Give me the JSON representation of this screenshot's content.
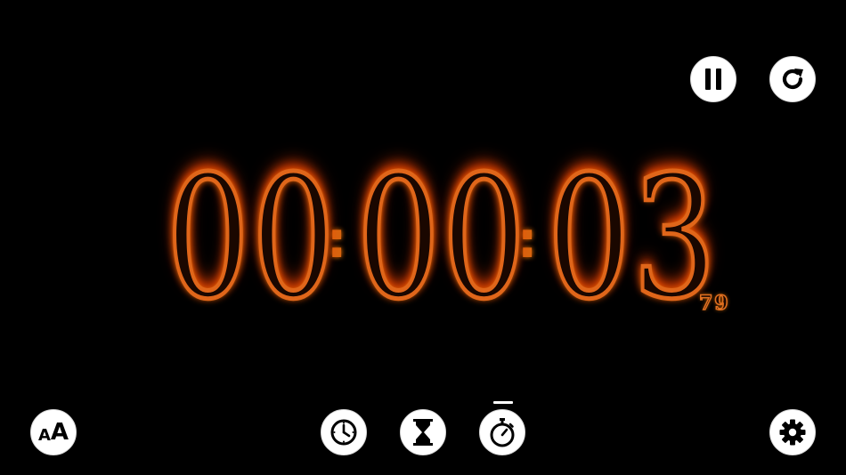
{
  "clock": {
    "digits": [
      "0",
      "0",
      "0",
      "0",
      "0",
      "3"
    ],
    "separator": ":",
    "hundredths": "79"
  },
  "controls": {
    "font_small": "A",
    "font_big": "A"
  },
  "modes": {
    "active": "stopwatch"
  },
  "colors": {
    "background": "#000000",
    "button_fill": "#ffffff",
    "icon": "#000000",
    "fire_outer": "#ff6a00",
    "fire_inner": "#e0661a"
  },
  "icons": {
    "pause": "pause-icon",
    "reset": "reload-icon",
    "font": "font-size-icon",
    "clock": "clock-icon",
    "timer": "hourglass-icon",
    "stopwatch": "stopwatch-icon",
    "settings": "gear-icon"
  }
}
